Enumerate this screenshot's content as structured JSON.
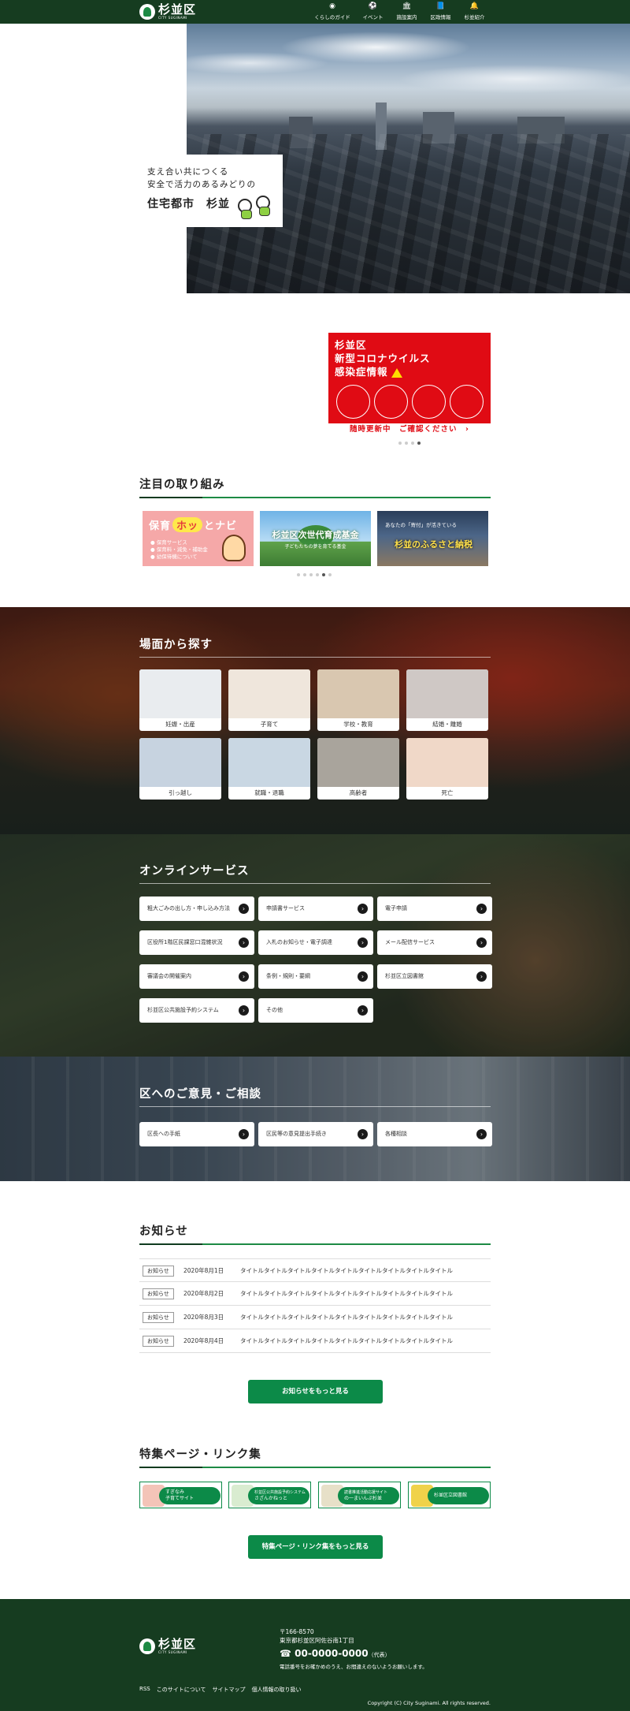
{
  "header": {
    "logo_text": "杉並区",
    "logo_sub": "CITY SUGINAMI",
    "nav": [
      {
        "icon": "person-circle-icon",
        "glyph": "◉",
        "label": "くらしのガイド"
      },
      {
        "icon": "soccer-ball-icon",
        "glyph": "⚽",
        "label": "イベント"
      },
      {
        "icon": "building-icon",
        "glyph": "🏛",
        "label": "施設案内"
      },
      {
        "icon": "book-icon",
        "glyph": "📘",
        "label": "区政情報"
      },
      {
        "icon": "bell-icon",
        "glyph": "🔔",
        "label": "杉並紹介"
      }
    ]
  },
  "hero": {
    "line1": "支え合い共につくる",
    "line2": "安全で活力のあるみどりの",
    "big": "住宅都市　杉並"
  },
  "covid": {
    "line1": "杉並区",
    "line2": "新型コロナウイルス",
    "line3": "感染症情報",
    "more": "随時更新中　ご確認ください　›",
    "accent": "#e00b14"
  },
  "featured": {
    "title": "注目の取り組み",
    "hoiku": {
      "a": "保育",
      "hot": "ホッ",
      "b": "とナビ",
      "items": [
        "● 保育サービス",
        "● 保育料・減免・補助金",
        "● 幼保待機について"
      ]
    },
    "fund": {
      "title": "杉並区次世代育成基金",
      "sub": "子どもたちの夢を育てる基金"
    },
    "furusato": {
      "top": "あなたの「寄付」が活きている",
      "big": "杉並のふるさと納税"
    }
  },
  "scene": {
    "title": "場面から探す",
    "items": [
      "妊娠・出産",
      "子育て",
      "学校・教育",
      "結婚・離婚",
      "引っ越し",
      "就職・退職",
      "高齢者",
      "死亡"
    ]
  },
  "online": {
    "title": "オンラインサービス",
    "items": [
      "粗大ごみの出し方・申し込み方法",
      "申請書サービス",
      "電子申請",
      "区役所1階区民課窓口混雑状況",
      "入札のお知らせ・電子調達",
      "メール配信サービス",
      "審議会の開催案内",
      "条例・規則・要綱",
      "杉並区立図書館",
      "杉並区公共施設予約システム",
      "その他"
    ]
  },
  "opinion": {
    "title": "区へのご意見・ご相談",
    "items": [
      "区長への手紙",
      "区民等の意見提出手続き",
      "各種相談"
    ]
  },
  "news": {
    "title": "お知らせ",
    "rows": [
      {
        "tag": "お知らせ",
        "date": "2020年8月1日",
        "title": "タイトルタイトルタイトルタイトルタイトルタイトルタイトルタイトルタイトル"
      },
      {
        "tag": "お知らせ",
        "date": "2020年8月2日",
        "title": "タイトルタイトルタイトルタイトルタイトルタイトルタイトルタイトルタイトル"
      },
      {
        "tag": "お知らせ",
        "date": "2020年8月3日",
        "title": "タイトルタイトルタイトルタイトルタイトルタイトルタイトルタイトルタイトル"
      },
      {
        "tag": "お知らせ",
        "date": "2020年8月4日",
        "title": "タイトルタイトルタイトルタイトルタイトルタイトルタイトルタイトルタイトル"
      }
    ],
    "more": "お知らせをもっと見る"
  },
  "links": {
    "title": "特集ページ・リンク集",
    "items": [
      {
        "a": "すぎなみ",
        "b": "子育てサイト"
      },
      {
        "a": "杉並区公共施設予約システム",
        "b": "さざんかねっと"
      },
      {
        "a": "読書推進活動応援サイト",
        "b": "の一まいんぷ杉並"
      },
      {
        "a": "",
        "b": "杉並区立図書館"
      }
    ],
    "more": "特集ページ・リンク集をもっと見る"
  },
  "footer": {
    "zip": "〒166-8570",
    "address": "東京都杉並区阿佐谷南1丁目",
    "tel": "00-0000-0000",
    "tel_note": "（代表）",
    "note": "電話番号をお確かめのうえ、お間違えのないようお願いします。",
    "links": [
      "RSS",
      "このサイトについて",
      "サイトマップ",
      "個人情報の取り扱い"
    ],
    "copyright": "Copyright (C) City Suginami. All rights reserved."
  },
  "colors": {
    "brand_dark": "#163c20",
    "brand_green": "#0c8a48"
  }
}
